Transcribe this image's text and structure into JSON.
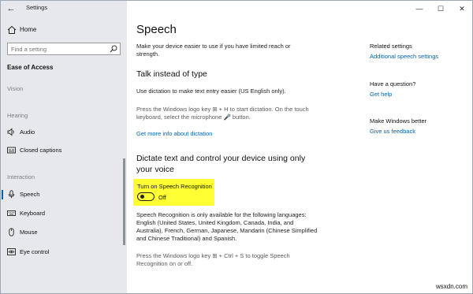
{
  "app": {
    "title": "Settings",
    "back_glyph": "←"
  },
  "sidebar": {
    "home_label": "Home",
    "search_placeholder": "Find a setting",
    "section_title": "Ease of Access",
    "groups": [
      {
        "label": "Vision"
      },
      {
        "label": "Hearing"
      },
      {
        "label": "Interaction"
      }
    ],
    "items": [
      {
        "label": "Audio",
        "icon": "speaker-icon"
      },
      {
        "label": "Closed captions",
        "icon": "captions-icon"
      },
      {
        "label": "Speech",
        "icon": "microphone-icon",
        "active": true
      },
      {
        "label": "Keyboard",
        "icon": "keyboard-icon"
      },
      {
        "label": "Mouse",
        "icon": "mouse-icon"
      },
      {
        "label": "Eye control",
        "icon": "eye-control-icon"
      }
    ]
  },
  "window_controls": {
    "minimize": "—",
    "maximize": "☐",
    "close": "✕"
  },
  "main": {
    "title": "Speech",
    "intro": [
      "Make your device easier to use if you have limited reach or",
      "strength."
    ],
    "dictation": {
      "heading": "Talk instead of type",
      "desc": "Use dictation to make text entry easier (US English only).",
      "hint": [
        "Press the Windows logo key ⊞ + H to start dictation.  On the touch",
        "keyboard, select the microphone 🎤 button."
      ],
      "link": "Get more info about dictation"
    },
    "recognition": {
      "heading": [
        "Dictate text and control your device using only",
        "your voice"
      ],
      "toggle_label": "Turn on Speech Recognition",
      "toggle_state": "Off",
      "toggle_on": false,
      "availability": [
        "Speech Recognition is only available for the following languages:",
        "English (United States, United Kingdom, Canada, India, and",
        "Australia), French, German, Japanese, Mandarin (Chinese Simplified",
        "and Chinese Traditional) and Spanish."
      ],
      "shortcut": [
        "Press the Windows logo key ⊞ + Ctrl + S to toggle Speech",
        "Recognition on or off."
      ]
    }
  },
  "right": {
    "related_heading": "Related settings",
    "related_link": "Additional speech settings",
    "question_heading": "Have a question?",
    "question_link": "Get help",
    "better_heading": "Make Windows better",
    "better_link": "Give us feedback"
  },
  "watermark": "wsxdn.com",
  "colors": {
    "accent": "#0063b1",
    "sidebar_bg": "#e6e8ee",
    "highlight": "#ffff33"
  }
}
